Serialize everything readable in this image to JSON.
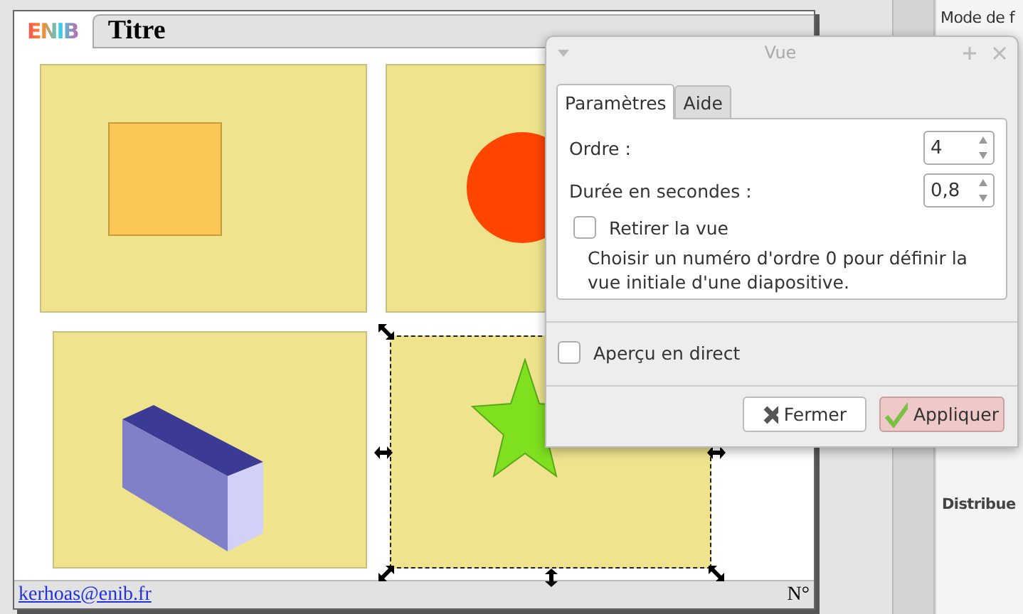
{
  "slide": {
    "logo": "ENIB",
    "title": "Titre",
    "footer_link": "kerhoas@enib.fr",
    "page_number": "N°",
    "frames": [
      {
        "kind": "square",
        "selected": false
      },
      {
        "kind": "circle",
        "selected": false
      },
      {
        "kind": "box",
        "selected": false
      },
      {
        "kind": "star",
        "selected": true
      }
    ]
  },
  "side_panel": {
    "heading": "Mode de f",
    "section": "Distribue"
  },
  "dialog": {
    "title": "Vue",
    "tabs": [
      {
        "label": "Paramètres",
        "selected": true
      },
      {
        "label": "Aide",
        "selected": false
      }
    ],
    "fields": [
      {
        "label": "Ordre :",
        "value": "4"
      },
      {
        "label": "Durée en secondes :",
        "value": "0,8"
      }
    ],
    "remove_view": {
      "label": "Retirer la vue",
      "checked": false
    },
    "hint": "Choisir un numéro d'ordre 0 pour définir la vue initiale d'une diapositive.",
    "live_preview": {
      "label": "Aperçu en direct",
      "checked": false
    },
    "buttons": [
      {
        "label": "Fermer",
        "kind": "close"
      },
      {
        "label": "Appliquer",
        "kind": "apply"
      }
    ]
  }
}
